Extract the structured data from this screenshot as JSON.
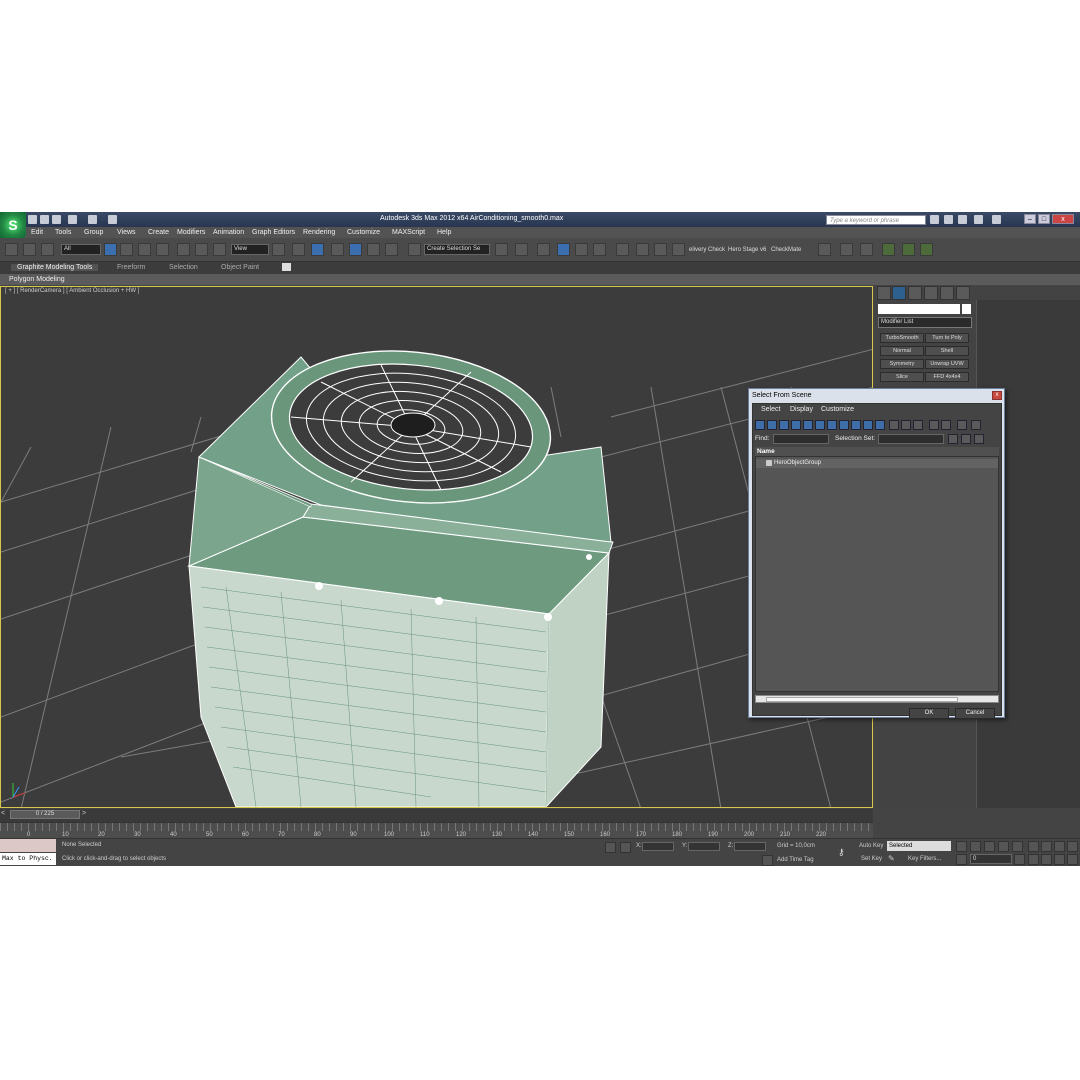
{
  "window": {
    "title": "Autodesk 3ds Max  2012 x64      AirConditioning_smooth0.max",
    "search_placeholder": "Type a keyword or phrase"
  },
  "menu": [
    "Edit",
    "Tools",
    "Group",
    "Views",
    "Create",
    "Modifiers",
    "Animation",
    "Graph Editors",
    "Rendering",
    "Customize",
    "MAXScript",
    "Help"
  ],
  "toolbar": {
    "filter": "All",
    "coord_system": "View",
    "selection_set": "Create Selection Se",
    "text_items": [
      "elivery Check",
      "Hero Stage v6",
      "CheckMate"
    ]
  },
  "ribbon": {
    "tabs": [
      "Graphite Modeling Tools",
      "Freeform",
      "Selection",
      "Object Paint"
    ],
    "sub": "Polygon Modeling"
  },
  "viewport": {
    "label": "[ + ] [ RenderCamera ] [ Ambient Occlusion + HW ]",
    "axis_labels": [
      "y",
      "z",
      "x"
    ]
  },
  "command_panel": {
    "modifier_list": "Modifier List",
    "modifiers": [
      "TurboSmooth",
      "Turn to Poly",
      "Normal",
      "Shell",
      "Symmetry",
      "Unwrap UVW",
      "Slice",
      "FFD 4x4x4"
    ]
  },
  "dialog": {
    "title": "Select From Scene",
    "menu": [
      "Select",
      "Display",
      "Customize"
    ],
    "find_label": "Find:",
    "selection_set_label": "Selection Set:",
    "column_name": "Name",
    "item": "HeroObjectGroup",
    "ok": "OK",
    "cancel": "Cancel"
  },
  "timeline": {
    "slider": "0 / 225",
    "ticks": [
      "0",
      "10",
      "20",
      "30",
      "40",
      "50",
      "60",
      "70",
      "80",
      "90",
      "100",
      "110",
      "120",
      "130",
      "140",
      "150",
      "160",
      "170",
      "180",
      "190",
      "200",
      "210",
      "220"
    ]
  },
  "status": {
    "maxscript": "Max to Physc.",
    "selection": "None Selected",
    "prompt": "Click or click-and-drag to select objects",
    "x_label": "X:",
    "y_label": "Y:",
    "z_label": "Z:",
    "grid": "Grid = 10,0cm",
    "add_time_tag": "Add Time Tag",
    "auto_key": "Auto Key",
    "auto_key_mode": "Selected",
    "set_key": "Set Key",
    "key_filters": "Key Filters...",
    "frame": "0"
  },
  "colors": {
    "grid_line": "#8a8a8a",
    "model_green": "#6f9a80",
    "wire": "#ffffff",
    "viewport_bg": "#3c3c3c",
    "accent_blue": "#3c6fb0"
  }
}
